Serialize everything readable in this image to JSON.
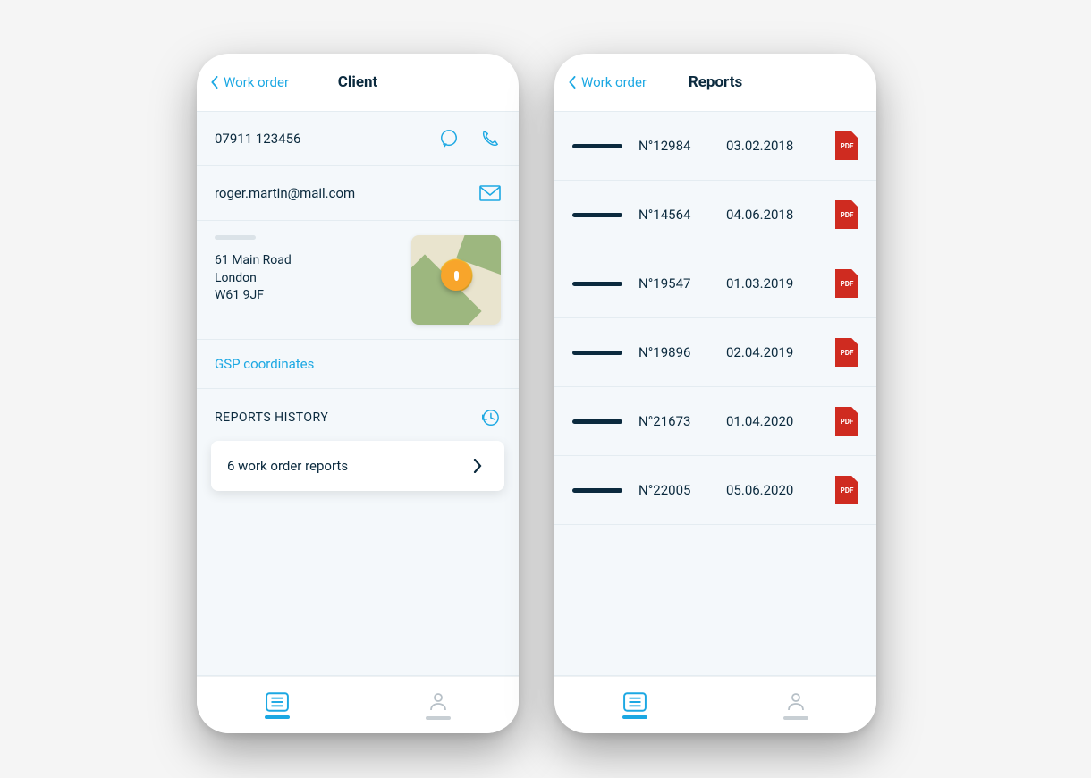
{
  "client": {
    "back_label": "Work order",
    "title": "Client",
    "phone": "07911 123456",
    "email": "roger.martin@mail.com",
    "address_line1": "61 Main Road",
    "address_city": "London",
    "address_postcode": "W61 9JF",
    "gps_link": "GSP coordinates",
    "reports_heading": "REPORTS HISTORY",
    "reports_card": "6 work order reports"
  },
  "reports": {
    "back_label": "Work order",
    "title": "Reports",
    "items": [
      {
        "num": "N°12984",
        "date": "03.02.2018"
      },
      {
        "num": "N°14564",
        "date": "04.06.2018"
      },
      {
        "num": "N°19547",
        "date": "01.03.2019"
      },
      {
        "num": "N°19896",
        "date": "02.04.2019"
      },
      {
        "num": "N°21673",
        "date": "01.04.2020"
      },
      {
        "num": "N°22005",
        "date": "05.06.2020"
      }
    ]
  },
  "colors": {
    "accent": "#1ca8e3",
    "text": "#0b2a3e",
    "pdf": "#cf2b20"
  }
}
